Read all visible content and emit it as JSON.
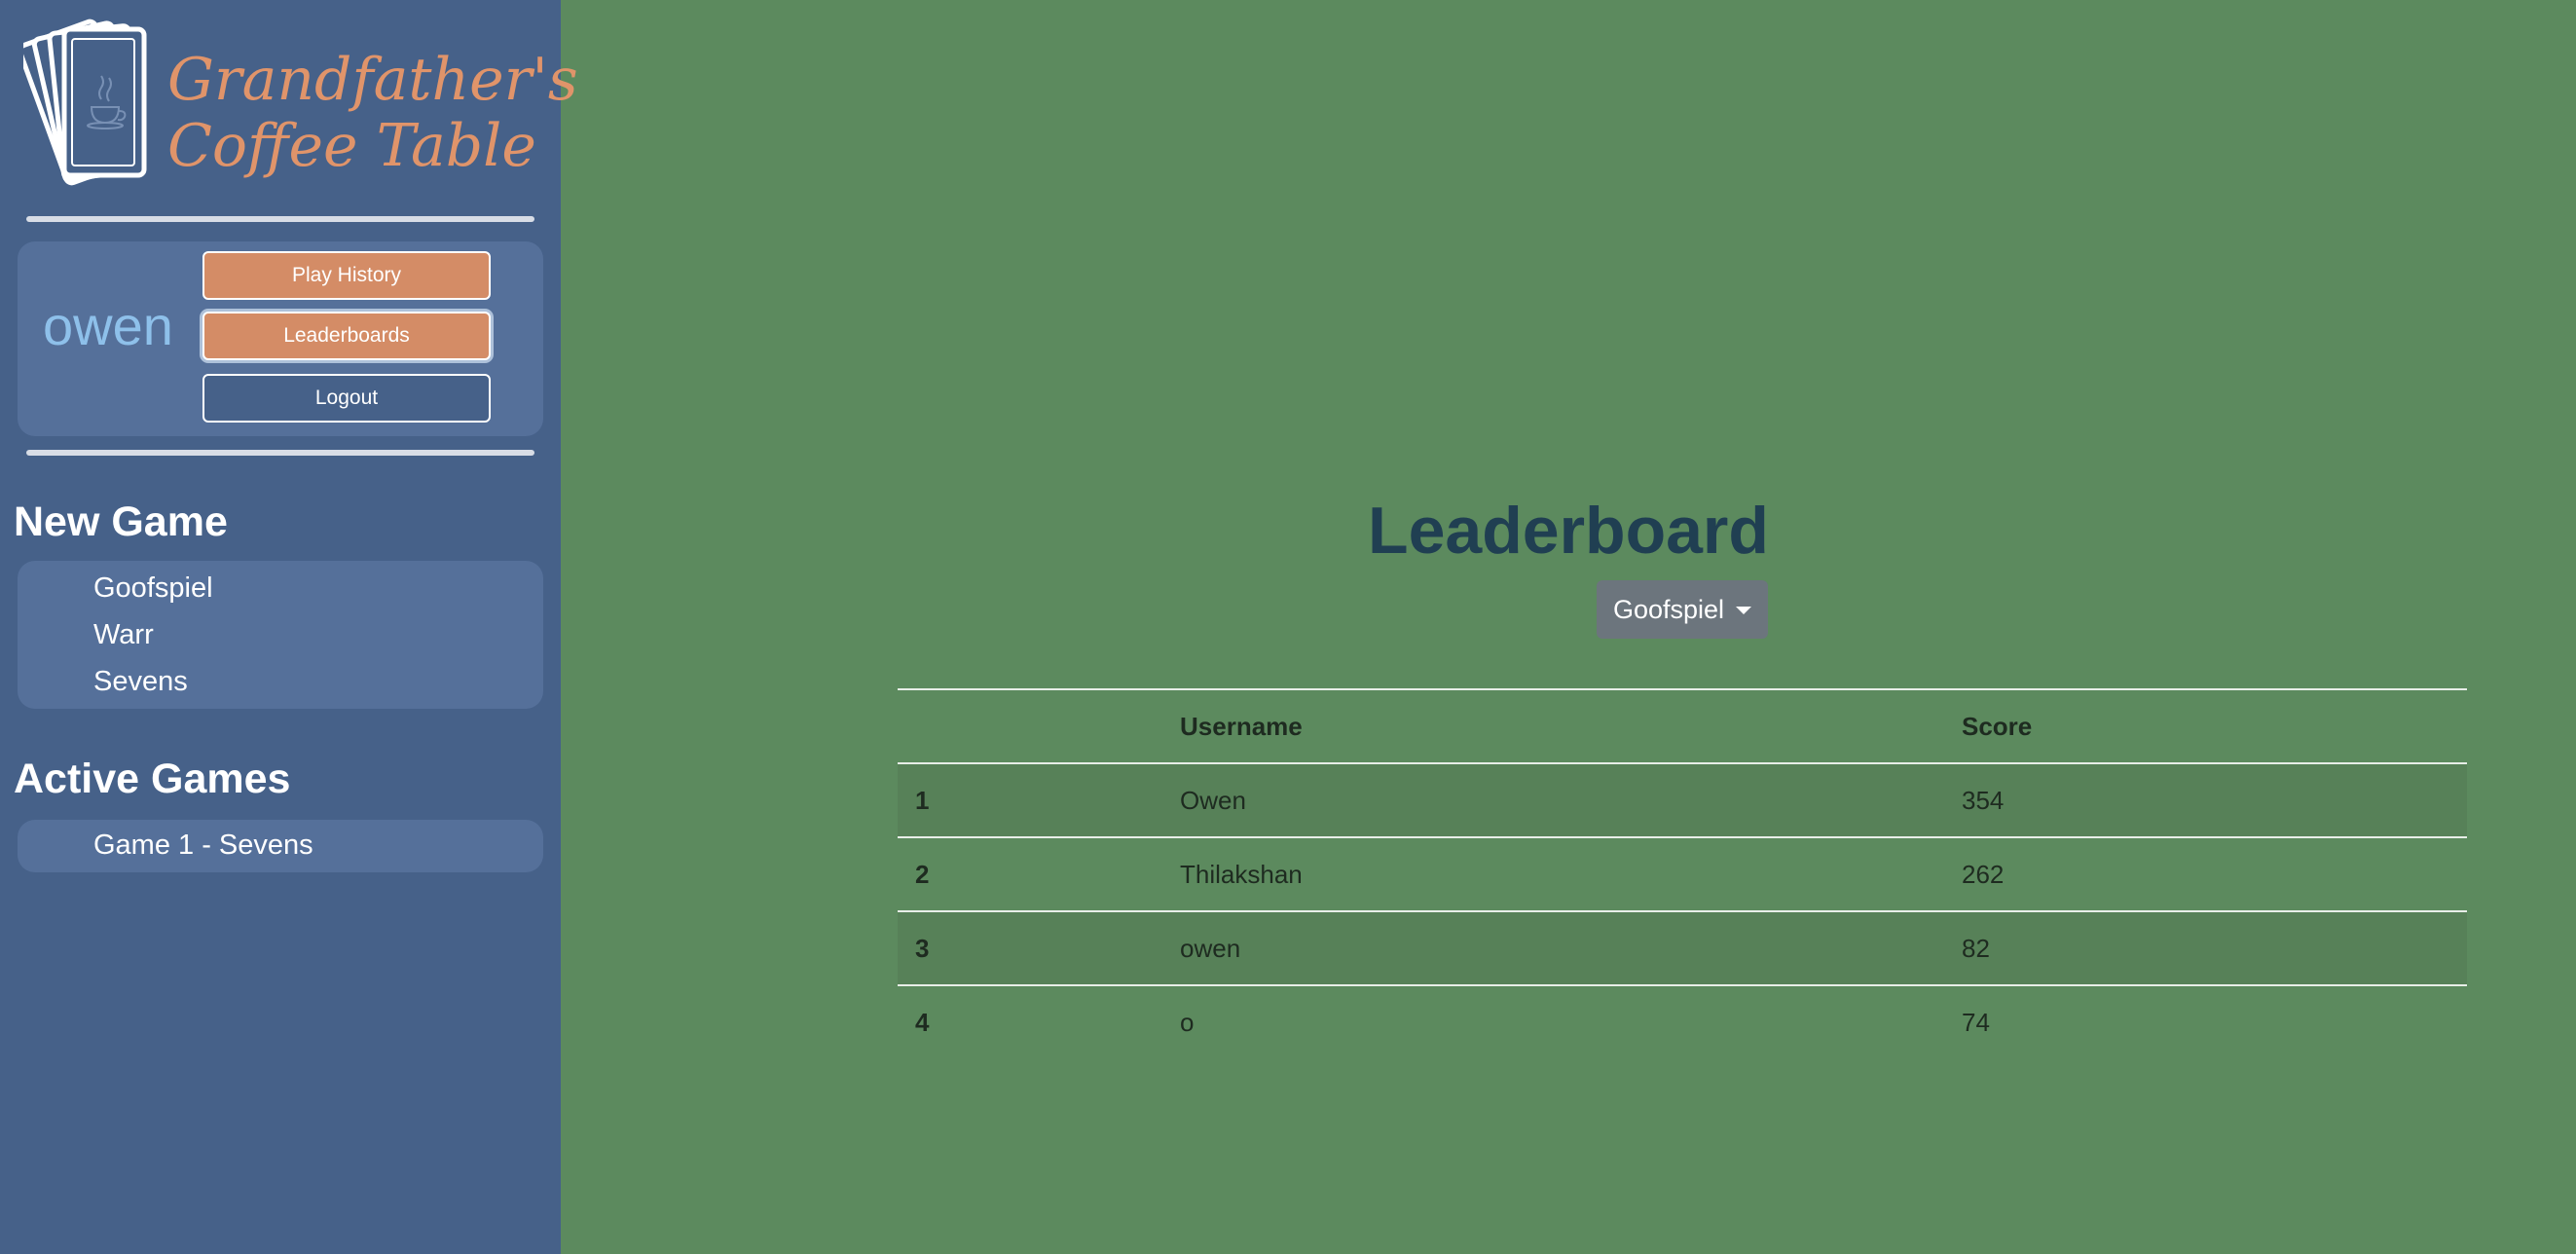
{
  "app": {
    "logo_line1": "Grandfather's",
    "logo_line2": "Coffee Table"
  },
  "user": {
    "name": "owen",
    "buttons": {
      "play_history": "Play History",
      "leaderboards": "Leaderboards",
      "logout": "Logout"
    }
  },
  "new_game": {
    "title": "New Game",
    "items": [
      "Goofspiel",
      "Warr",
      "Sevens"
    ]
  },
  "active_games": {
    "title": "Active Games",
    "items": [
      "Game 1 - Sevens"
    ]
  },
  "leaderboard": {
    "title": "Leaderboard",
    "selected_game": "Goofspiel",
    "columns": [
      "",
      "Username",
      "Score"
    ],
    "rows": [
      {
        "rank": "1",
        "username": "Owen",
        "score": "354"
      },
      {
        "rank": "2",
        "username": "Thilakshan",
        "score": "262"
      },
      {
        "rank": "3",
        "username": "owen",
        "score": "82"
      },
      {
        "rank": "4",
        "username": "o",
        "score": "74"
      }
    ]
  },
  "colors": {
    "sidebar": "#466189",
    "panel": "#55709a",
    "main_bg": "#5c8a5e",
    "accent_orange": "#d48c66",
    "username": "#8ec0ea",
    "title": "#203f52"
  }
}
